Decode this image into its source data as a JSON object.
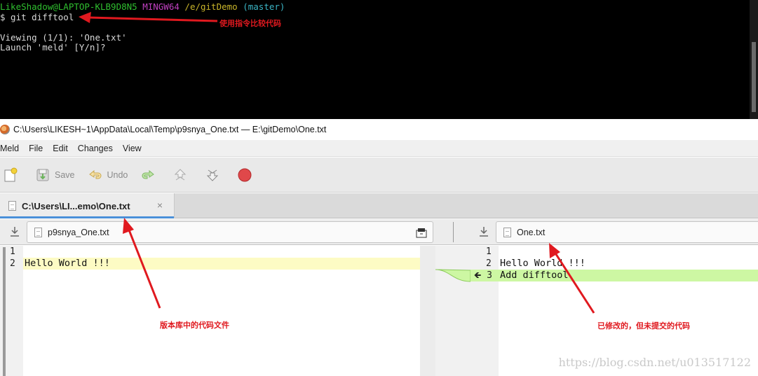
{
  "terminal": {
    "prompt_user": "LikeShadow@LAPTOP-KLB9D8N5",
    "prompt_env": "MINGW64",
    "prompt_path": "/e/gitDemo",
    "prompt_branch": "(master)",
    "command": "$ git difftool",
    "viewing": "Viewing (1/1): 'One.txt'",
    "launch": "Launch 'meld' [Y/n]?",
    "annotation": "使用指令比较代码"
  },
  "window": {
    "title": "C:\\Users\\LIKESH~1\\AppData\\Local\\Temp\\p9snya_One.txt — E:\\gitDemo\\One.txt"
  },
  "menu": [
    "Meld",
    "File",
    "Edit",
    "Changes",
    "View"
  ],
  "toolbar": {
    "save_label": "Save",
    "undo_label": "Undo"
  },
  "tab": {
    "label": "C:\\Users\\LI...emo\\One.txt",
    "close": "×"
  },
  "left_file": {
    "name": "p9snya_One.txt",
    "lines": [
      {
        "num": "1",
        "text": ""
      },
      {
        "num": "2",
        "text": "Hello World !!!"
      }
    ]
  },
  "right_file": {
    "name": "One.txt",
    "lines": [
      {
        "num": "1",
        "text": ""
      },
      {
        "num": "2",
        "text": "Hello World !!!"
      },
      {
        "num": "3",
        "text": "Add difftool"
      }
    ]
  },
  "annotations": {
    "left": "版本库中的代码文件",
    "right": "已修改的，但未提交的代码"
  },
  "watermark": "https://blog.csdn.net/u013517122",
  "colors": {
    "terminal_bg": "#000000",
    "changed_line": "#fdfbc4",
    "inserted_line": "#cdf7a3",
    "annotation_red": "#e0191f",
    "tab_underline": "#4a90d9"
  }
}
